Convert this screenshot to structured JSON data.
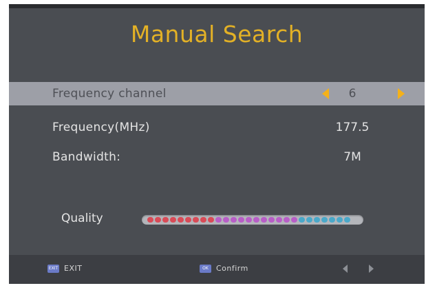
{
  "title": "Manual Search",
  "rows": [
    {
      "label": "Frequency channel",
      "value": "6"
    },
    {
      "label": "Frequency(MHz)",
      "value": "177.5"
    },
    {
      "label": "Bandwidth:",
      "value": "7M"
    }
  ],
  "quality": {
    "label": "Quality",
    "level": 1.0,
    "segment_colors": [
      "#d94b57",
      "#b85ec7",
      "#4aa8c9"
    ]
  },
  "footer": {
    "exit_key": "EXIT",
    "exit_label": "EXIT",
    "ok_key": "OK",
    "confirm_label": "Confirm"
  },
  "colors": {
    "title": "#e3b126",
    "selected_row": "#9d9fa7",
    "arrow": "#f4b11a",
    "key_icon": "#6b7bc8"
  }
}
